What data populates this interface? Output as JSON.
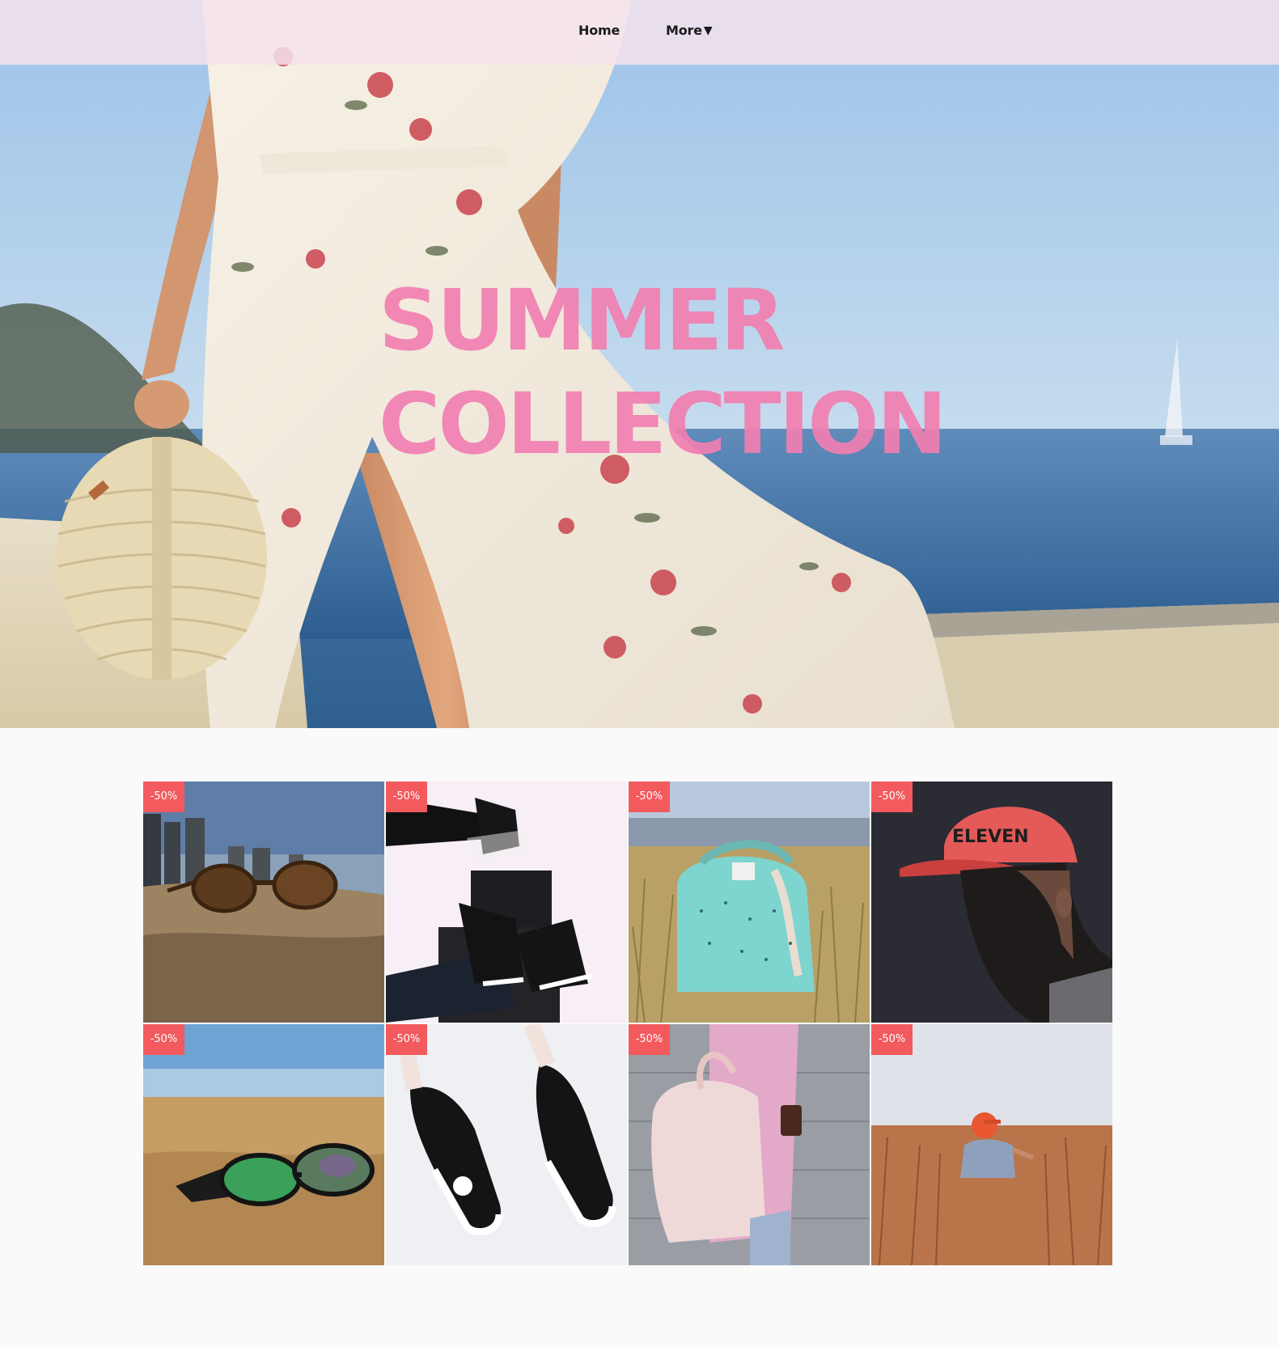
{
  "nav": {
    "home_label": "Home",
    "more_label": "More",
    "more_caret": "▼"
  },
  "hero": {
    "headline_line1": "SUMMER",
    "headline_line2": "COLLECTION",
    "headline_color": "#f27fb1",
    "image": "woman-floral-dress-beach"
  },
  "products": [
    {
      "badge": "-50%",
      "image": "sunglasses-on-sand"
    },
    {
      "badge": "-50%",
      "image": "black-sneakers-steps"
    },
    {
      "badge": "-50%",
      "image": "mint-backpack-field"
    },
    {
      "badge": "-50%",
      "image": "man-red-cap"
    },
    {
      "badge": "-50%",
      "image": "green-lens-sunglasses-beach"
    },
    {
      "badge": "-50%",
      "image": "converse-high-tops"
    },
    {
      "badge": "-50%",
      "image": "pink-backpack-woman"
    },
    {
      "badge": "-50%",
      "image": "man-orange-cap-field"
    }
  ],
  "colors": {
    "badge_bg": "#f25a5e",
    "nav_bg": "#f4e2ec",
    "page_bg": "#fafafa"
  }
}
